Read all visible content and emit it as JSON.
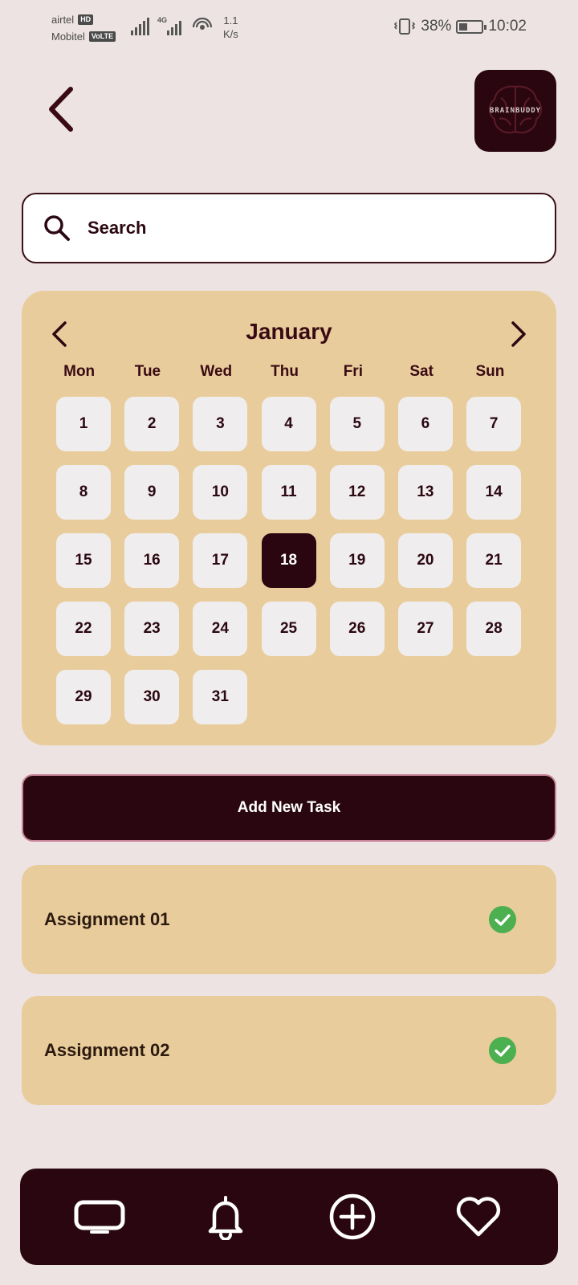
{
  "status_bar": {
    "carrier1": "airtel",
    "carrier1_badge": "HD",
    "carrier2": "Mobitel",
    "carrier2_badge": "VoLTE",
    "network": "4G",
    "speed_value": "1.1",
    "speed_unit": "K/s",
    "battery": "38%",
    "time": "10:02"
  },
  "header": {
    "back_icon": "chevron-left-icon",
    "logo_text": "BRAINBUDDY"
  },
  "search": {
    "placeholder": "Search"
  },
  "calendar": {
    "month": "January",
    "weekdays": [
      "Mon",
      "Tue",
      "Wed",
      "Thu",
      "Fri",
      "Sat",
      "Sun"
    ],
    "days": [
      "1",
      "2",
      "3",
      "4",
      "5",
      "6",
      "7",
      "8",
      "9",
      "10",
      "11",
      "12",
      "13",
      "14",
      "15",
      "16",
      "17",
      "18",
      "19",
      "20",
      "21",
      "22",
      "23",
      "24",
      "25",
      "26",
      "27",
      "28",
      "29",
      "30",
      "31"
    ],
    "selected_day": "18"
  },
  "actions": {
    "add_task_label": "Add New Task"
  },
  "tasks": [
    {
      "title": "Assignment 01",
      "status_icon": "check-circle-icon"
    },
    {
      "title": "Assignment 02",
      "status_icon": "check-circle-icon"
    }
  ],
  "bottom_nav": [
    {
      "icon": "tv-icon"
    },
    {
      "icon": "bell-icon"
    },
    {
      "icon": "plus-circle-icon"
    },
    {
      "icon": "heart-icon"
    }
  ],
  "colors": {
    "background": "#ece3e2",
    "primary_dark": "#2a0710",
    "card_tan": "#e9cc9b",
    "day_tile": "#efeded",
    "check_green": "#4caf50"
  }
}
